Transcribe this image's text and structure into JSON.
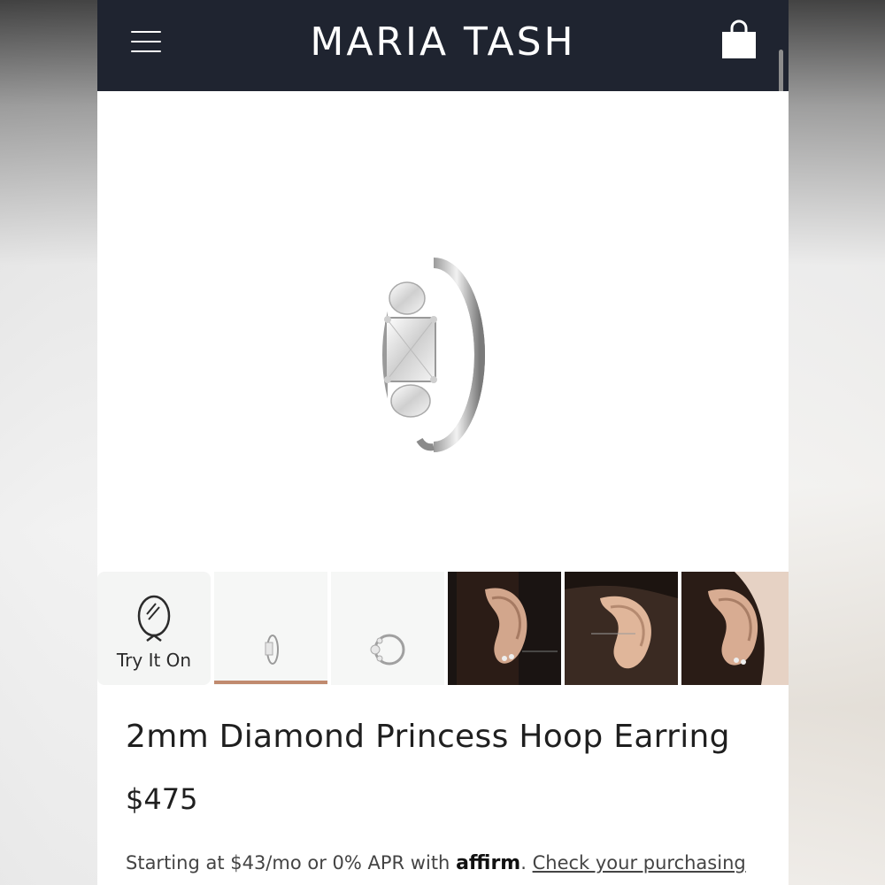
{
  "header": {
    "brand": "MARIA TASH",
    "menu_icon": "hamburger-menu-icon",
    "cart_icon": "shopping-bag-icon",
    "background": "#1f2430"
  },
  "gallery": {
    "main_image": "diamond-princess-hoop-earring",
    "try_on_label": "Try It On",
    "try_on_icon": "mirror-icon",
    "thumbnails": [
      "hoop-side-view",
      "hoop-front-view",
      "ear-model-1",
      "ear-model-2",
      "ear-model-3"
    ],
    "active_indicator_color": "#c08a6f"
  },
  "product": {
    "title": "2mm Diamond Princess Hoop Earring",
    "price": "$475"
  },
  "financing": {
    "text": "Starting at $43/mo or 0% APR with",
    "provider": "affirm",
    "separator": ".",
    "link_text": "Check your purchasing"
  }
}
